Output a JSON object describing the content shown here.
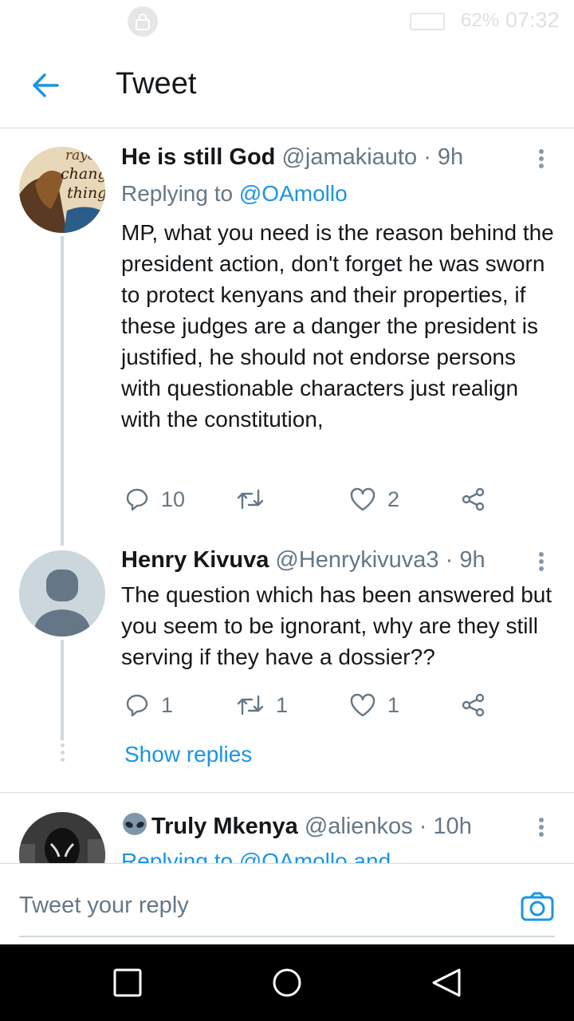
{
  "status_bar": {
    "battery": "62%",
    "time": "07:32"
  },
  "header": {
    "title": "Tweet"
  },
  "tweets": [
    {
      "display_name": "He is still God",
      "handle": "@jamakiauto",
      "time": "· 9h",
      "replying_prefix": "Replying to",
      "replying_to": "@OAmollo",
      "text": "MP, what you need is the reason behind the president action, don't forget he was sworn to protect  kenyans and their properties, if these judges are a danger the president is justified, he should not endorse persons with questionable characters just realign with the constitution,",
      "replies": "10",
      "retweets": "",
      "likes": "2",
      "avatar_text": [
        "rayer",
        "chang",
        "thing"
      ]
    },
    {
      "display_name": "Henry Kivuva",
      "handle": "@Henrykivuva3",
      "time": "· 9h",
      "text": "The question which has been answered but you seem to be ignorant, why are they still serving if they have a dossier??",
      "replies": "1",
      "retweets": "1",
      "likes": "1"
    },
    {
      "display_name": "Truly Mkenya",
      "handle": "@alienkos",
      "time": "· 10h",
      "replying_text": "Replying to @OAmollo and"
    }
  ],
  "show_replies": "Show replies",
  "reply_bar": {
    "placeholder": "Tweet your reply"
  },
  "icons": {
    "accent": "#1b95e0",
    "muted": "#657786"
  }
}
